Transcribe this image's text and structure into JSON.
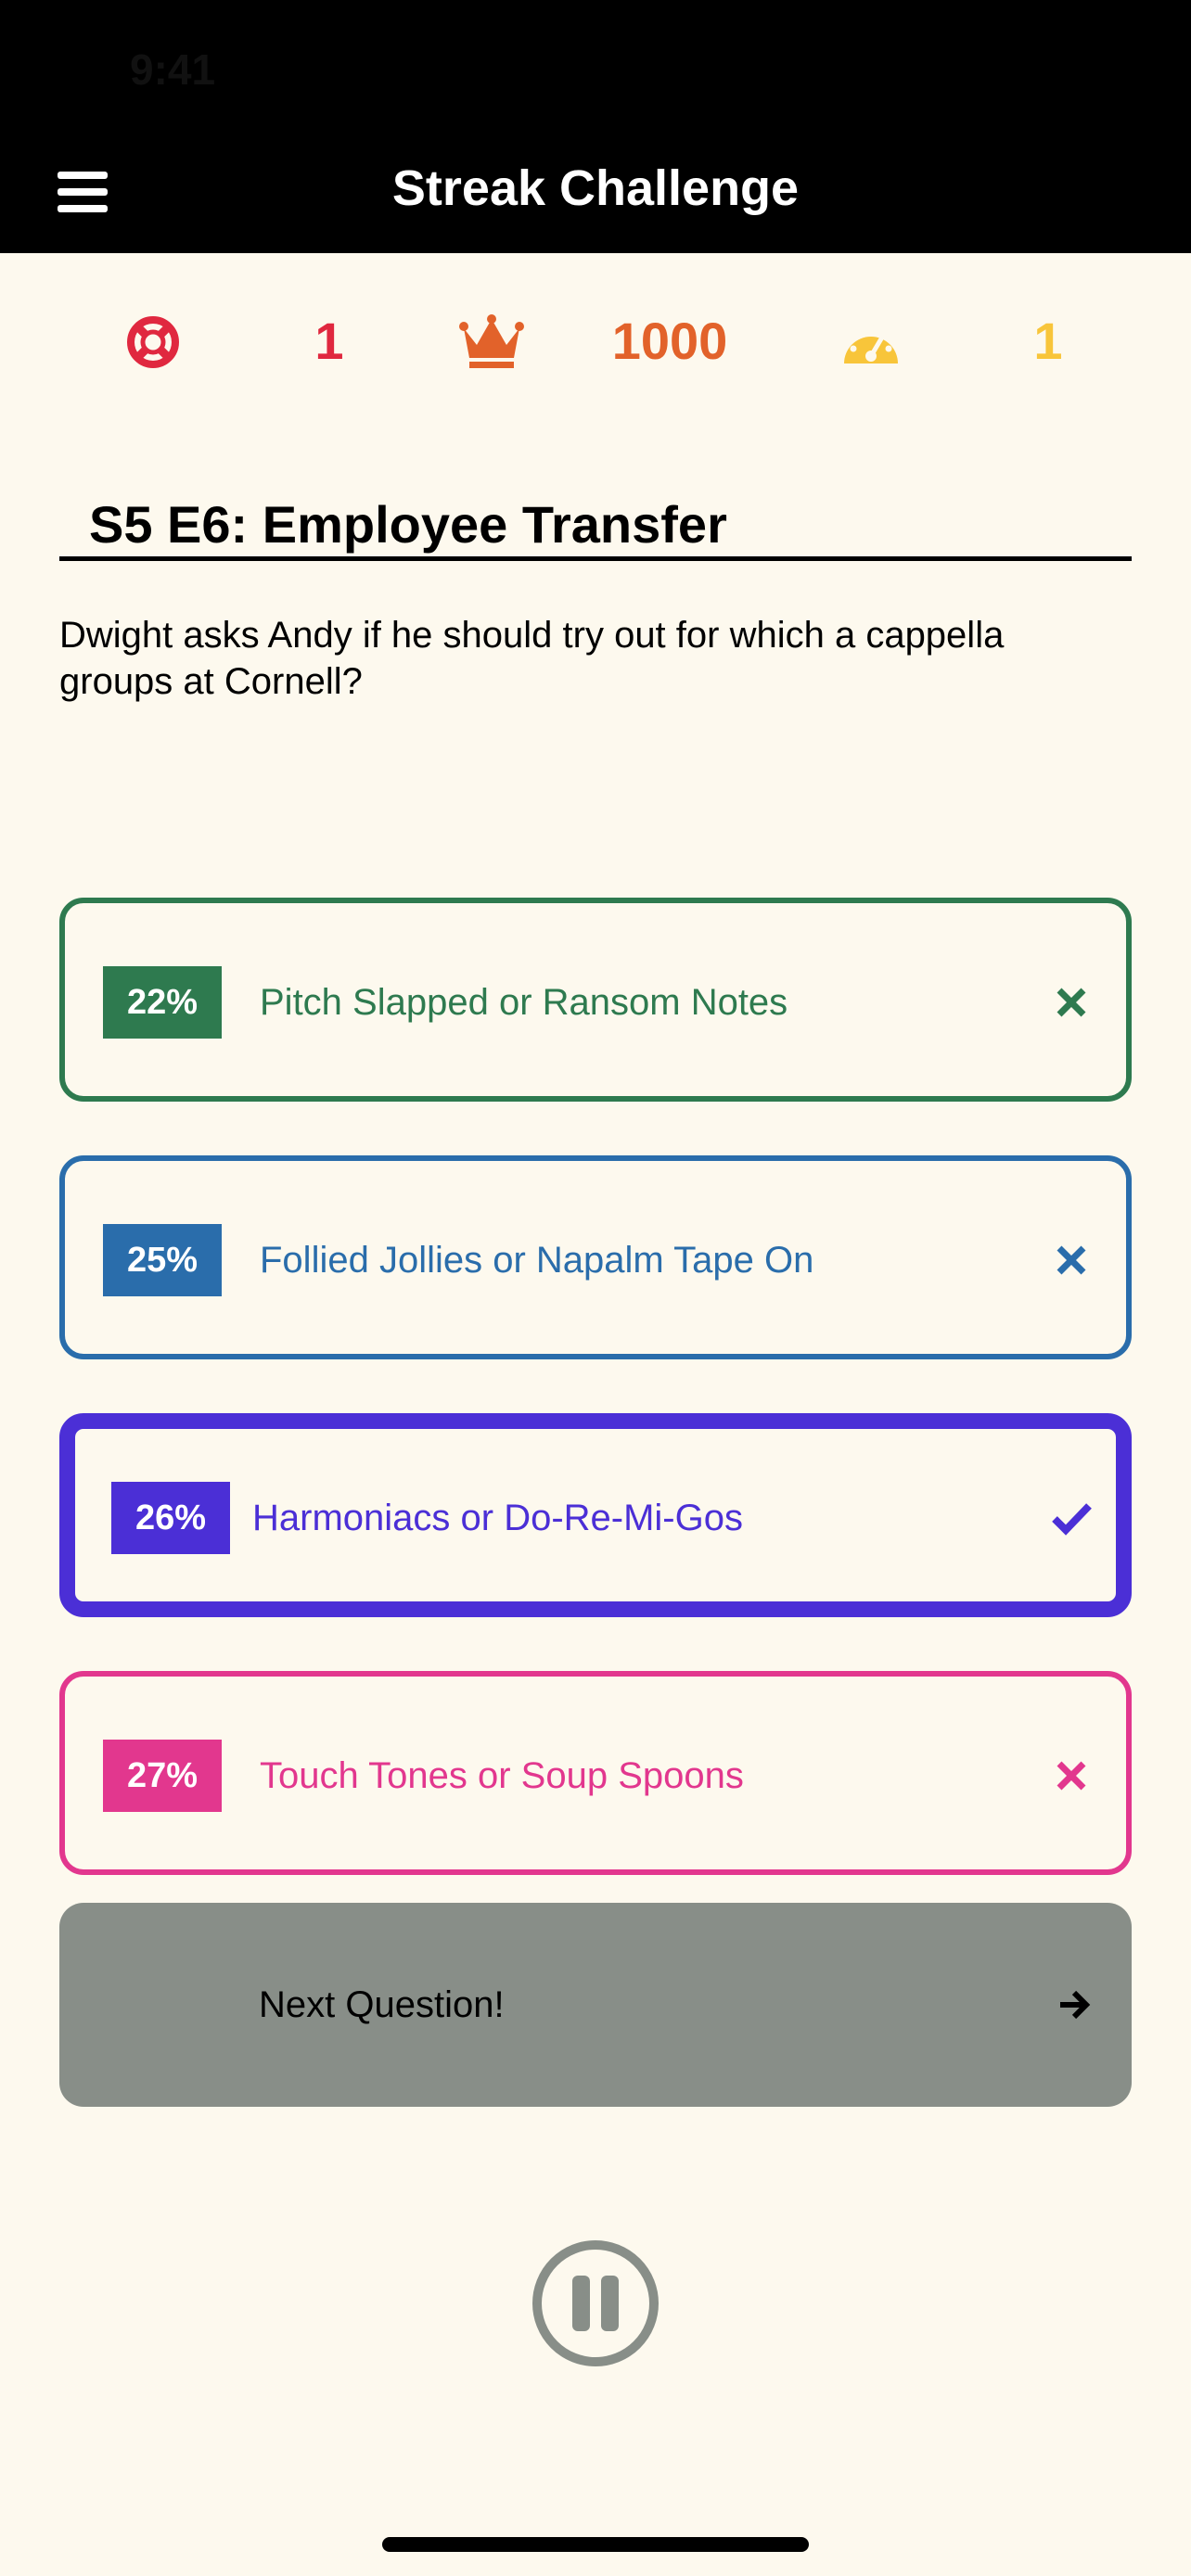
{
  "status_bar": {
    "time": "9:41"
  },
  "header": {
    "title": "Streak Challenge"
  },
  "stats": {
    "lives": {
      "value": "1",
      "icon": "lifebuoy-icon",
      "color": "#e0283f"
    },
    "high_score": {
      "value": "1000",
      "icon": "crown-icon",
      "color": "#e2622a"
    },
    "speed": {
      "value": "1",
      "icon": "speedometer-icon",
      "color": "#f8c53a"
    }
  },
  "episode": {
    "title": "S5 E6: Employee Transfer"
  },
  "question": {
    "text": "Dwight asks Andy if he should try out for which a cappella groups at Cornell?"
  },
  "answers": [
    {
      "percent": "22%",
      "label": "Pitch Slapped or Ransom Notes",
      "status": "incorrect",
      "color": "#2e7a4f"
    },
    {
      "percent": "25%",
      "label": "Follied Jollies or Napalm Tape On",
      "status": "incorrect",
      "color": "#2a6dab"
    },
    {
      "percent": "26%",
      "label": "Harmoniacs or Do-Re-Mi-Gos",
      "status": "correct",
      "color": "#4b2fd6"
    },
    {
      "percent": "27%",
      "label": "Touch Tones or Soup Spoons",
      "status": "incorrect",
      "color": "#e2378e"
    }
  ],
  "next_button": {
    "label": "Next Question!",
    "icon": "arrow-right-icon"
  },
  "pause_button": {
    "icon": "pause-icon"
  }
}
